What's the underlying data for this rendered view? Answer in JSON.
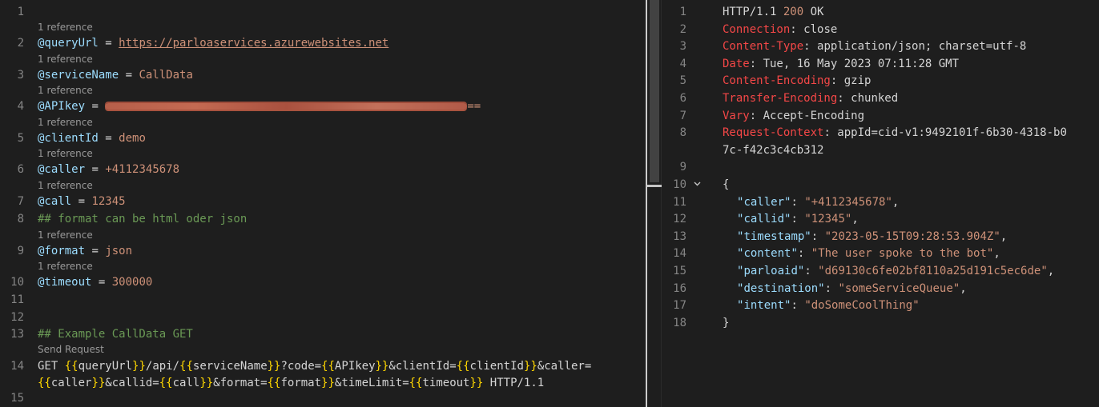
{
  "left": {
    "lines": [
      {
        "n": "1"
      },
      {
        "n": "2",
        "lens": "1 reference",
        "var": "@queryUrl",
        "value": "https://parloaservices.azurewebsites.net"
      },
      {
        "n": "3",
        "lens": "1 reference",
        "var": "@serviceName",
        "value": "CallData"
      },
      {
        "n": "4",
        "lens": "1 reference",
        "var": "@APIkey",
        "value_tail": "=="
      },
      {
        "n": "5",
        "lens": "1 reference",
        "var": "@clientId",
        "value": "demo"
      },
      {
        "n": "6",
        "lens": "1 reference",
        "var": "@caller",
        "value": "+4112345678"
      },
      {
        "n": "7",
        "lens": "1 reference",
        "var": "@call",
        "value": "12345"
      },
      {
        "n": "8",
        "comment": "## format can be html oder json"
      },
      {
        "n": "9",
        "lens": "1 reference",
        "var": "@format",
        "value": "json"
      },
      {
        "n": "10",
        "lens": "1 reference",
        "var": "@timeout",
        "value": "300000"
      },
      {
        "n": "11"
      },
      {
        "n": "12"
      },
      {
        "n": "13",
        "comment": "## Example CallData GET"
      },
      {
        "n": "14",
        "lens": "Send Request"
      },
      {
        "n": "15"
      }
    ],
    "request": {
      "method": "GET",
      "v_queryUrl": "queryUrl",
      "p_api": "/api/",
      "v_serviceName": "serviceName",
      "p_code": "?code=",
      "v_apikey": "APIkey",
      "p_client": "&clientId=",
      "v_clientId": "clientId",
      "p_caller": "&caller=",
      "v_caller": "caller",
      "p_callid": "&callid=",
      "v_call": "call",
      "p_format": "&format=",
      "v_format": "format",
      "p_time": "&timeLimit=",
      "v_timeout": "timeout",
      "http": " HTTP/1.1"
    }
  },
  "right": {
    "status_line": {
      "proto": "HTTP/1.1 ",
      "code": "200",
      "text": " OK"
    },
    "headers": [
      {
        "n": "2",
        "name": "Connection",
        "value": "close"
      },
      {
        "n": "3",
        "name": "Content-Type",
        "value": "application/json; charset=utf-8"
      },
      {
        "n": "4",
        "name": "Date",
        "value": "Tue, 16 May 2023 07:11:28 GMT"
      },
      {
        "n": "5",
        "name": "Content-Encoding",
        "value": "gzip"
      },
      {
        "n": "6",
        "name": "Transfer-Encoding",
        "value": "chunked"
      },
      {
        "n": "7",
        "name": "Vary",
        "value": "Accept-Encoding"
      },
      {
        "n": "8",
        "name": "Request-Context",
        "value": "appId=cid-v1:9492101f-6b30-4318-b0",
        "wrap": "7c-f42c3c4cb312"
      }
    ],
    "json": [
      {
        "n": "11",
        "key": "caller",
        "value": "+4112345678"
      },
      {
        "n": "12",
        "key": "callid",
        "value": "12345"
      },
      {
        "n": "13",
        "key": "timestamp",
        "value": "2023-05-15T09:28:53.904Z"
      },
      {
        "n": "14",
        "key": "content",
        "value": "The user spoke to the bot"
      },
      {
        "n": "15",
        "key": "parloaid",
        "value": "d69130c6fe02bf8110a25d191c5ec6de"
      },
      {
        "n": "16",
        "key": "destination",
        "value": "someServiceQueue"
      },
      {
        "n": "17",
        "key": "intent",
        "value": "doSomeCoolThing"
      }
    ],
    "gutter": {
      "n1": "1",
      "n9": "9",
      "n10": "10",
      "n18": "18"
    },
    "open_brace": "{",
    "close_brace": "}",
    "fold_icon": "chevron-down-icon"
  }
}
